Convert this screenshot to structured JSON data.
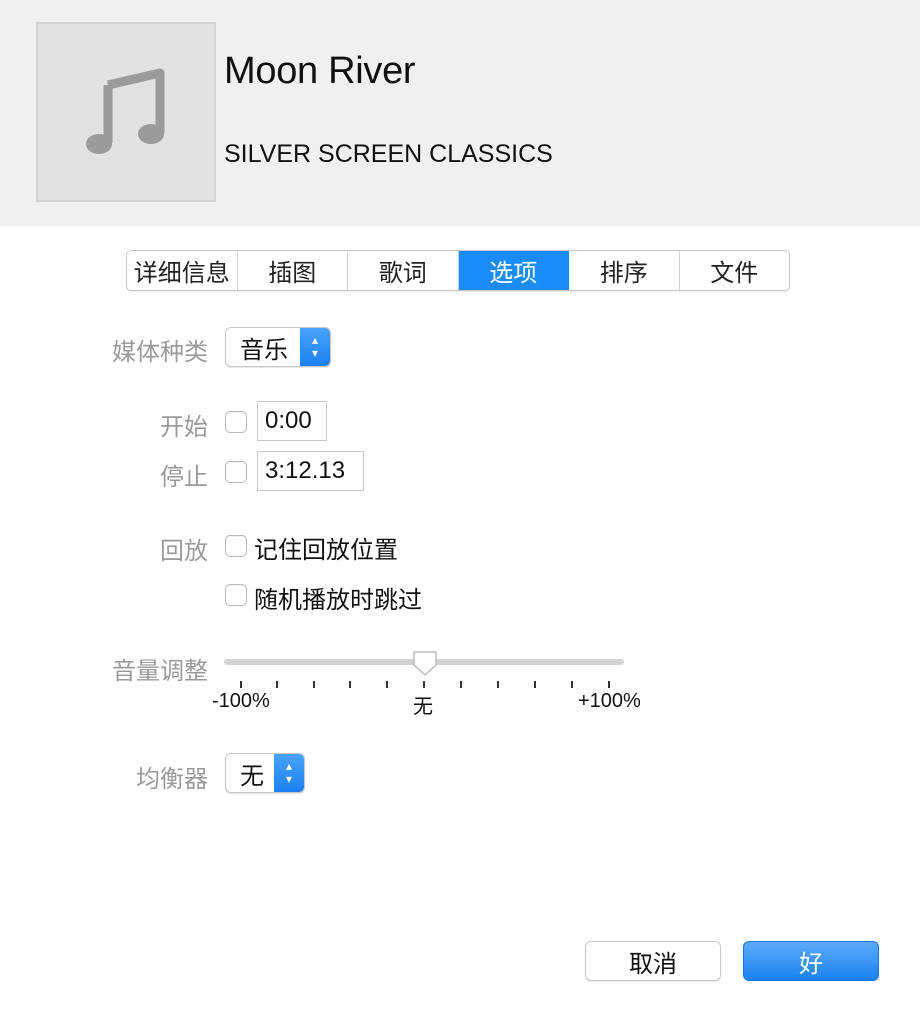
{
  "header": {
    "track_title": "Moon River",
    "album_title": "SILVER SCREEN CLASSICS",
    "artwork_icon": "music-note-icon"
  },
  "tabs": [
    {
      "label": "详细信息",
      "active": false
    },
    {
      "label": "插图",
      "active": false
    },
    {
      "label": "歌词",
      "active": false
    },
    {
      "label": "选项",
      "active": true
    },
    {
      "label": "排序",
      "active": false
    },
    {
      "label": "文件",
      "active": false
    }
  ],
  "options": {
    "media_kind_label": "媒体种类",
    "media_kind_value": "音乐",
    "start_label": "开始",
    "start_value": "0:00",
    "start_checked": false,
    "stop_label": "停止",
    "stop_value": "3:12.13",
    "stop_checked": false,
    "playback_label": "回放",
    "remember_position_label": "记住回放位置",
    "remember_position_checked": false,
    "skip_shuffle_label": "随机播放时跳过",
    "skip_shuffle_checked": false,
    "volume_label": "音量调整",
    "volume_min_label": "-100%",
    "volume_mid_label": "无",
    "volume_max_label": "+100%",
    "volume_value_percent": 0,
    "equalizer_label": "均衡器",
    "equalizer_value": "无"
  },
  "buttons": {
    "cancel_label": "取消",
    "ok_label": "好"
  },
  "colors": {
    "accent": "#1a8cf7",
    "header_bg": "#f0f0f0",
    "label_gray": "#9a9a9a"
  }
}
